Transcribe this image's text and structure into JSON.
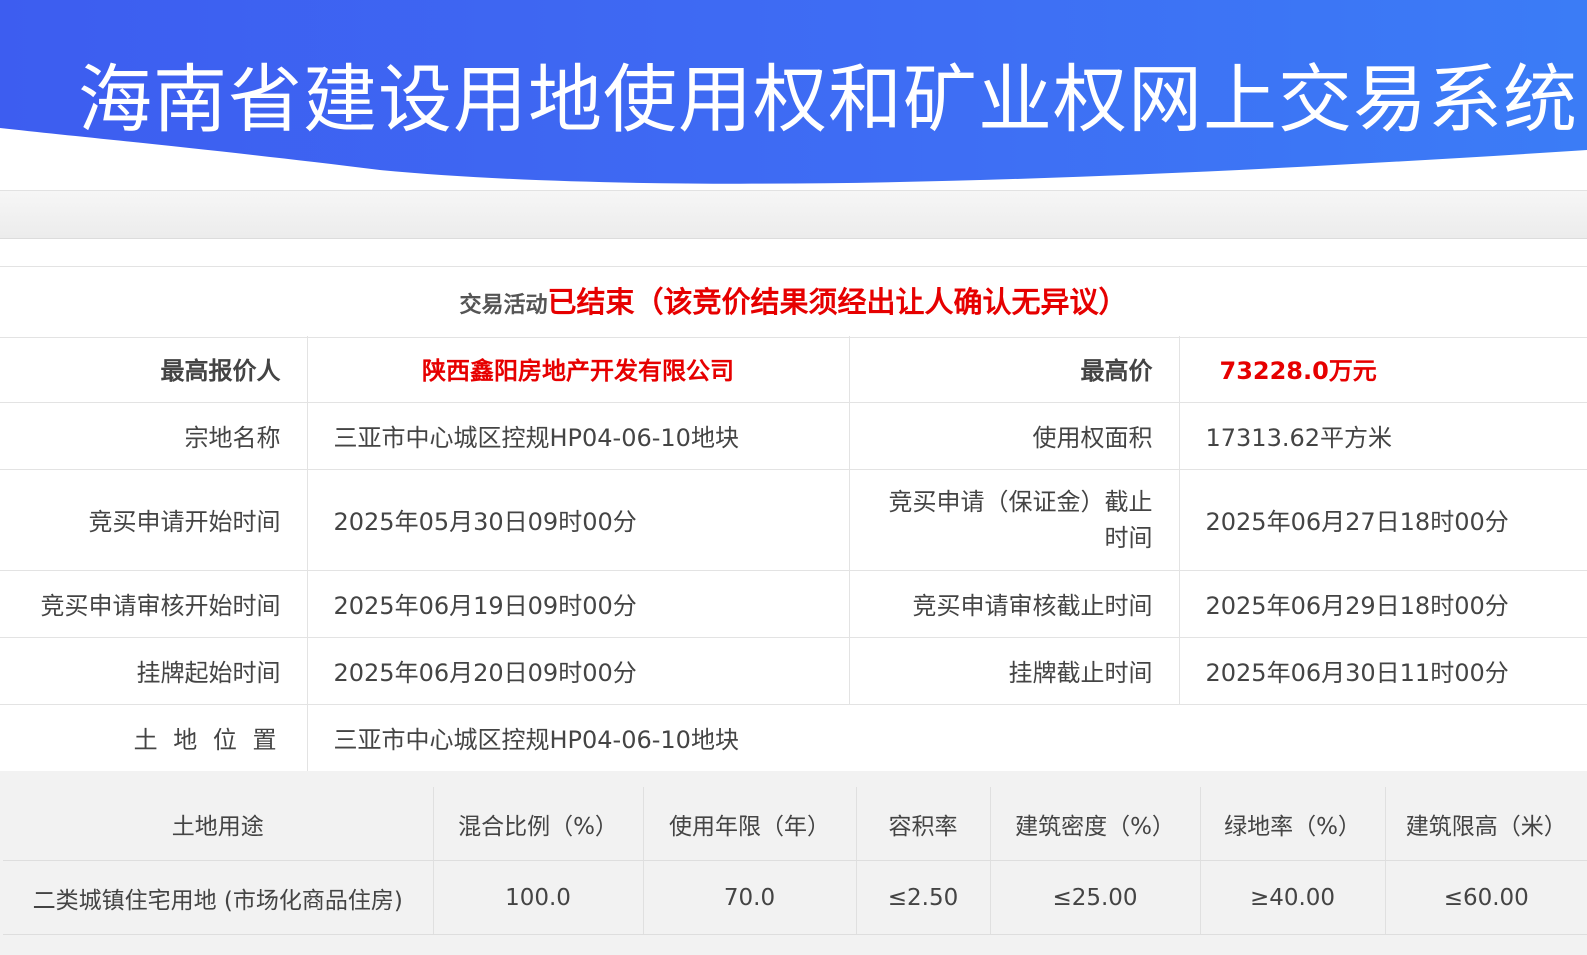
{
  "header": {
    "title": "海南省建设用地使用权和矿业权网上交易系统"
  },
  "status": {
    "label": "交易活动",
    "value": "已结束（该竞价结果须经出让人确认无异议）"
  },
  "info": {
    "bidder_label": "最高报价人",
    "bidder_value": "陕西鑫阳房地产开发有限公司",
    "price_label": "最高价",
    "price_value": "73228.0万元",
    "parcel_label": "宗地名称",
    "parcel_value": "三亚市中心城区控规HP04-06-10地块",
    "area_label": "使用权面积",
    "area_value": "17313.62平方米",
    "apply_start_label": "竞买申请开始时间",
    "apply_start_value": "2025年05月30日09时00分",
    "apply_end_label_1": "竞买申请（保证金）截止",
    "apply_end_label_2": "时间",
    "apply_end_value": "2025年06月27日18时00分",
    "review_start_label": "竞买申请审核开始时间",
    "review_start_value": "2025年06月19日09时00分",
    "review_end_label": "竞买申请审核截止时间",
    "review_end_value": "2025年06月29日18时00分",
    "list_start_label": "挂牌起始时间",
    "list_start_value": "2025年06月20日09时00分",
    "list_end_label": "挂牌截止时间",
    "list_end_value": "2025年06月30日11时00分",
    "location_label": "土 地 位 置",
    "location_value": "三亚市中心城区控规HP04-06-10地块"
  },
  "use_table": {
    "headers": [
      "土地用途",
      "混合比例（%）",
      "使用年限（年）",
      "容积率",
      "建筑密度（%）",
      "绿地率（%）",
      "建筑限高（米）"
    ],
    "row": [
      "二类城镇住宅用地 (市场化商品住房)",
      "100.0",
      "70.0",
      "≤2.50",
      "≤25.00",
      "≥40.00",
      "≤60.00"
    ]
  },
  "colors": {
    "banner_blue": "#3a67f0",
    "accent_red": "#e60000"
  }
}
